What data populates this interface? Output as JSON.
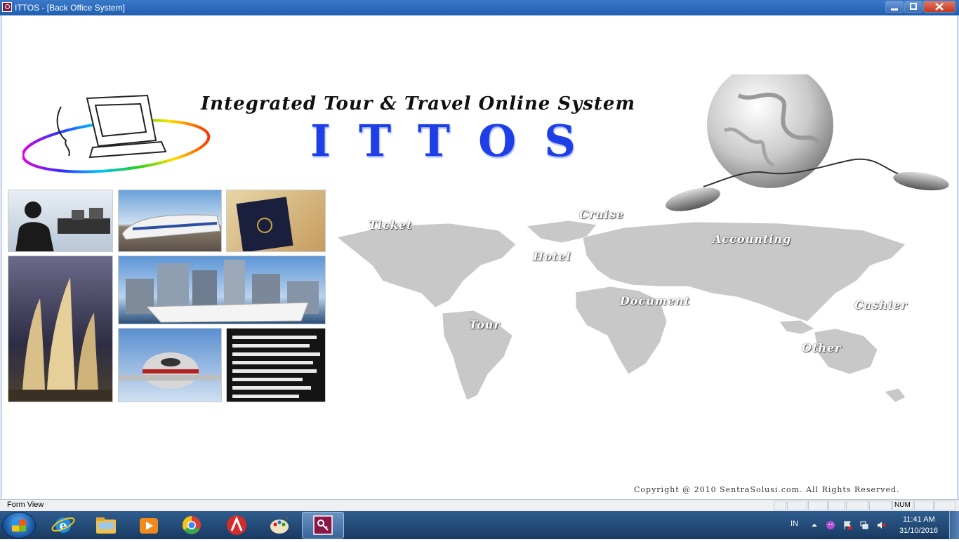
{
  "window": {
    "title": "ITTOS - [Back Office System]",
    "controls": {
      "minimize": "minimize-icon",
      "maximize": "maximize-icon",
      "close": "close-icon"
    }
  },
  "splash": {
    "tagline": "Integrated Tour & Travel Online System",
    "brand": "ITTOS",
    "map_labels": [
      "Ticket",
      "Cruise",
      "Hotel",
      "Accounting",
      "Document",
      "Tour",
      "Cashier",
      "Other"
    ],
    "photos": [
      "call-center-photo",
      "train-photo",
      "passport-photo",
      "towers-photo",
      "cruise-ship-photo",
      "airplane-photo",
      "departure-board-photo"
    ],
    "copyright": "Copyright @ 2010 SentraSolusi.com. All Rights Reserved."
  },
  "statusbar": {
    "text": "Form View",
    "num_indicator": "NUM"
  },
  "taskbar": {
    "apps": [
      "windows-start-icon",
      "internet-explorer-icon",
      "file-explorer-icon",
      "media-player-icon",
      "chrome-icon",
      "autocad-icon",
      "paint-icon",
      "access-icon"
    ],
    "language": "IN",
    "time": "11:41 AM",
    "date": "31/10/2016"
  },
  "colors": {
    "titlebar": "#1f5fb0",
    "brand": "#1e3ee6",
    "map": "#c8c8c8",
    "taskbar": "#183a62"
  }
}
